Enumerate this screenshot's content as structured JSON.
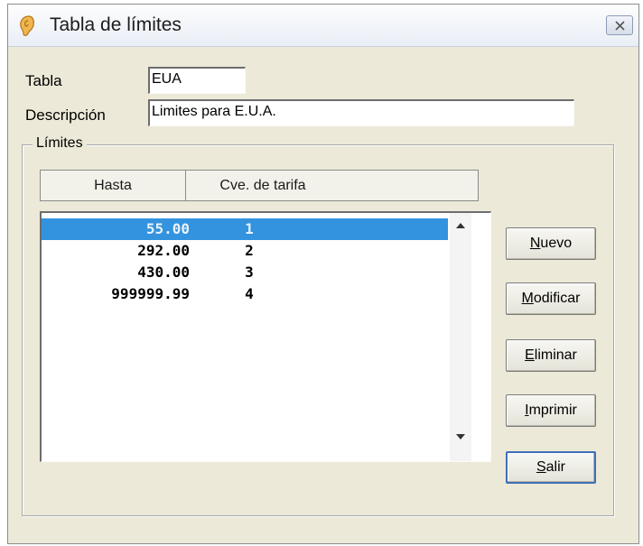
{
  "window": {
    "title": "Tabla de límites",
    "icon": "ear-app-icon",
    "close_icon": "close-icon"
  },
  "form": {
    "tabla_label": "Tabla",
    "tabla_value": "EUA",
    "descripcion_label": "Descripción",
    "descripcion_value": "Limites para E.U.A."
  },
  "limits": {
    "group_title": "Límites",
    "columns": [
      "Hasta",
      "Cve. de tarifa"
    ],
    "rows": [
      {
        "hasta": "55.00",
        "cve": "1",
        "selected": true
      },
      {
        "hasta": "292.00",
        "cve": "2",
        "selected": false
      },
      {
        "hasta": "430.00",
        "cve": "3",
        "selected": false
      },
      {
        "hasta": "999999.99",
        "cve": "4",
        "selected": false
      }
    ]
  },
  "buttons": {
    "nuevo": {
      "mnemonic": "N",
      "rest": "uevo"
    },
    "modificar": {
      "mnemonic": "M",
      "rest": "odificar"
    },
    "eliminar": {
      "mnemonic": "E",
      "rest": "liminar"
    },
    "imprimir": {
      "mnemonic": "I",
      "rest": "mprimir"
    },
    "salir": {
      "mnemonic": "S",
      "rest": "alir"
    }
  },
  "colors": {
    "selection": "#3393df",
    "dialog_bg": "#ece9d8"
  }
}
